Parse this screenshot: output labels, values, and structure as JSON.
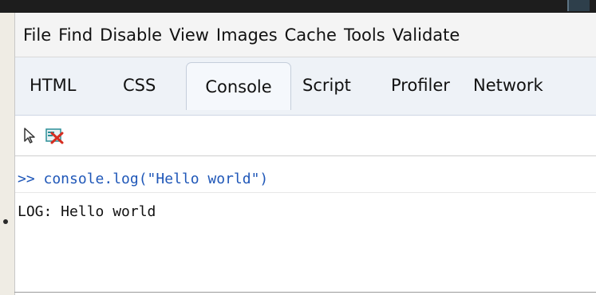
{
  "menu": {
    "items": [
      "File",
      "Find",
      "Disable",
      "View",
      "Images",
      "Cache",
      "Tools",
      "Validate"
    ]
  },
  "tabs": [
    {
      "label": "HTML"
    },
    {
      "label": "CSS"
    },
    {
      "label": "Console",
      "active": true
    },
    {
      "label": "Script"
    },
    {
      "label": "Profiler"
    },
    {
      "label": "Network"
    }
  ],
  "toolbar": {
    "icons": [
      "select-pointer-icon",
      "clear-console-icon"
    ]
  },
  "console": {
    "command": ">> console.log(\"Hello world\")",
    "output": "LOG: Hello world"
  },
  "colors": {
    "command_text": "#1f57b8",
    "output_text": "#111111",
    "clear_icon_red": "#d62d20",
    "clear_icon_teal": "#2b8f98"
  }
}
